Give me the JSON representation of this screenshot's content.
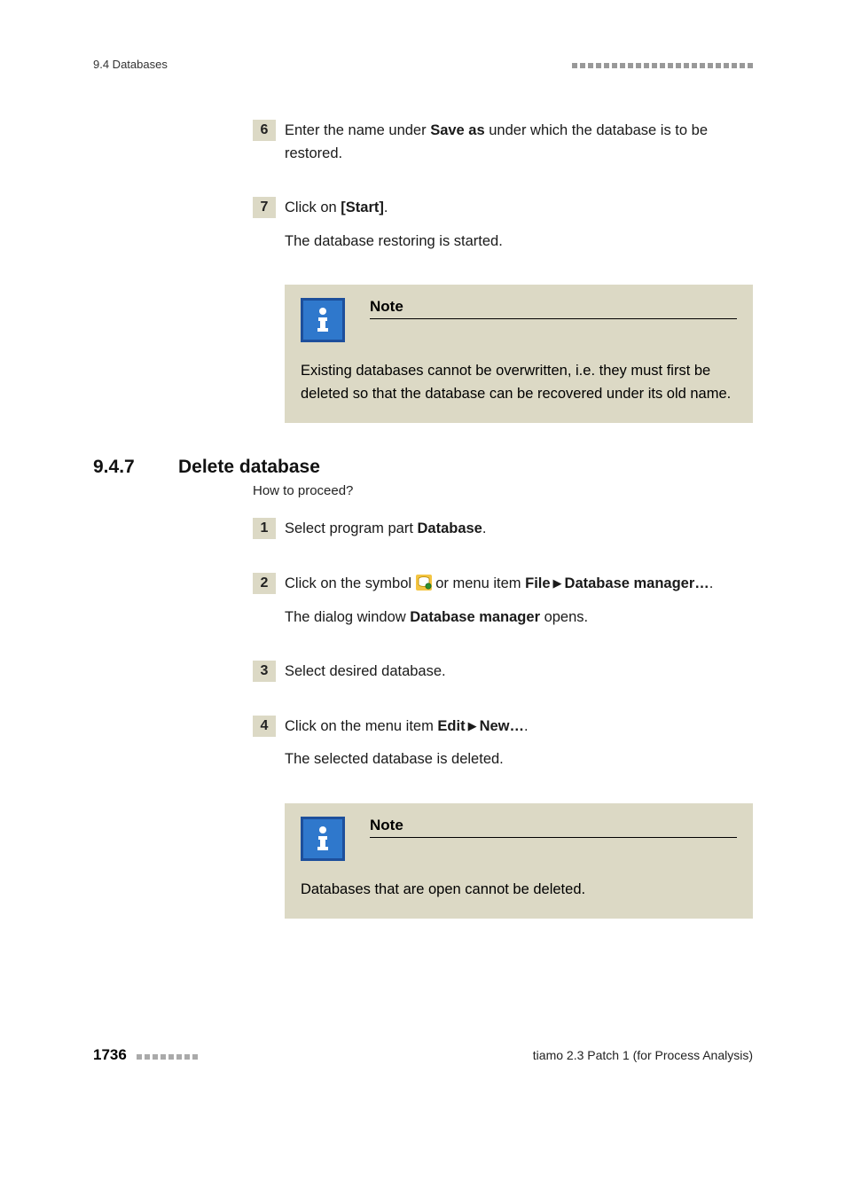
{
  "header": {
    "section_label": "9.4 Databases"
  },
  "steps_a": [
    {
      "num": "6",
      "text_pre": "Enter the name under ",
      "bold": "Save as",
      "text_post": " under which the database is to be restored."
    },
    {
      "num": "7",
      "text_pre": "Click on ",
      "bold": "[Start]",
      "text_post": ".",
      "sub": "The database restoring is started."
    }
  ],
  "note1": {
    "title": "Note",
    "body": "Existing databases cannot be overwritten, i.e. they must first be deleted so that the database can be recovered under its old name."
  },
  "section": {
    "num": "9.4.7",
    "title": "Delete database",
    "howto": "How to proceed?"
  },
  "steps_b": {
    "s1": {
      "num": "1",
      "pre": "Select program part ",
      "bold": "Database",
      "post": "."
    },
    "s2": {
      "num": "2",
      "pre": "Click on the symbol ",
      "mid": " or menu item ",
      "bold1": "File",
      "bold2": "Database manager…",
      "post": ".",
      "sub_pre": "The dialog window ",
      "sub_bold": "Database manager",
      "sub_post": " opens."
    },
    "s3": {
      "num": "3",
      "text": "Select desired database."
    },
    "s4": {
      "num": "4",
      "pre": "Click on the menu item ",
      "bold1": "Edit",
      "bold2": "New…",
      "post": ".",
      "sub": "The selected database is deleted."
    }
  },
  "note2": {
    "title": "Note",
    "body": "Databases that are open cannot be deleted."
  },
  "footer": {
    "page": "1736",
    "product": "tiamo 2.3 Patch 1 (for Process Analysis)"
  }
}
